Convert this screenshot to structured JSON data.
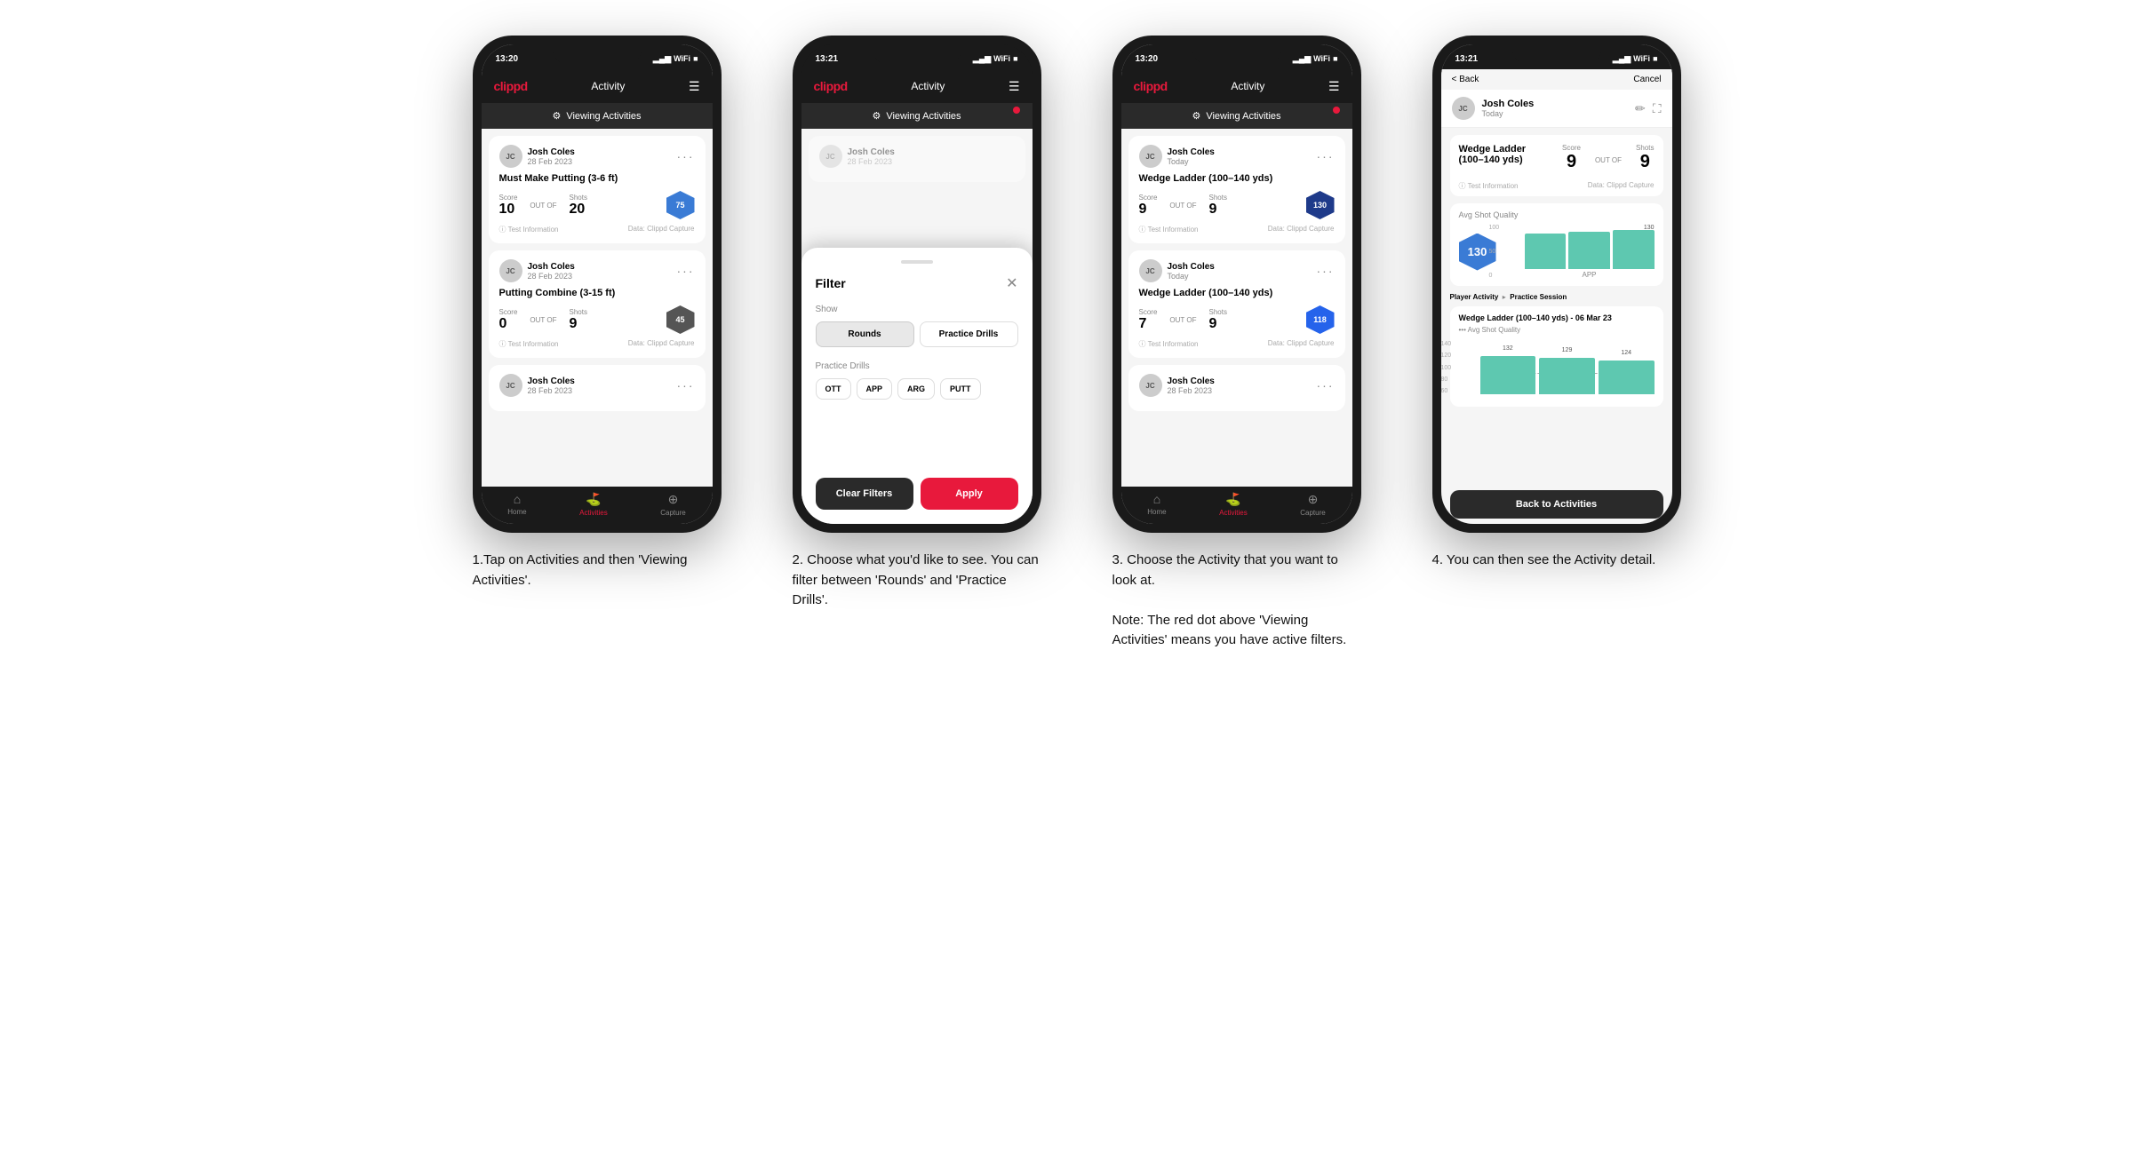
{
  "phones": [
    {
      "id": "phone1",
      "status_time": "13:20",
      "header": {
        "logo": "clippd",
        "title": "Activity",
        "menu_icon": "☰"
      },
      "banner": {
        "label": "Viewing Activities",
        "icon": "⚙",
        "has_red_dot": false
      },
      "cards": [
        {
          "user_name": "Josh Coles",
          "user_date": "28 Feb 2023",
          "drill_title": "Must Make Putting (3-6 ft)",
          "score_label": "Score",
          "shots_label": "Shots",
          "shot_quality_label": "Shot Quality",
          "score": "10",
          "out_of": "OUT OF",
          "shots": "20",
          "shot_quality": "75",
          "info_left": "ⓘ Test Information",
          "info_right": "Data: Clippd Capture"
        },
        {
          "user_name": "Josh Coles",
          "user_date": "28 Feb 2023",
          "drill_title": "Putting Combine (3-15 ft)",
          "score_label": "Score",
          "shots_label": "Shots",
          "shot_quality_label": "Shot Quality",
          "score": "0",
          "out_of": "OUT OF",
          "shots": "9",
          "shot_quality": "45",
          "info_left": "ⓘ Test Information",
          "info_right": "Data: Clippd Capture"
        },
        {
          "user_name": "Josh Coles",
          "user_date": "28 Feb 2023",
          "drill_title": "",
          "score_label": "",
          "shots_label": "",
          "shot_quality_label": "",
          "score": "",
          "out_of": "",
          "shots": "",
          "shot_quality": "",
          "info_left": "",
          "info_right": ""
        }
      ],
      "nav": [
        {
          "label": "Home",
          "icon": "⌂",
          "active": false
        },
        {
          "label": "Activities",
          "icon": "♟",
          "active": true
        },
        {
          "label": "Capture",
          "icon": "⊕",
          "active": false
        }
      ],
      "description": "1.Tap on Activities and then 'Viewing Activities'."
    },
    {
      "id": "phone2",
      "status_time": "13:21",
      "header": {
        "logo": "clippd",
        "title": "Activity",
        "menu_icon": "☰"
      },
      "banner": {
        "label": "Viewing Activities",
        "icon": "⚙",
        "has_red_dot": true
      },
      "filter": {
        "title": "Filter",
        "show_label": "Show",
        "rounds_label": "Rounds",
        "practice_drills_label": "Practice Drills",
        "practice_drills_section_label": "Practice Drills",
        "tags": [
          "OTT",
          "APP",
          "ARG",
          "PUTT"
        ],
        "clear_label": "Clear Filters",
        "apply_label": "Apply"
      },
      "cards": [
        {
          "user_name": "Josh Coles",
          "user_date": "28 Feb 2023"
        }
      ],
      "description": "2. Choose what you'd like to see. You can filter between 'Rounds' and 'Practice Drills'."
    },
    {
      "id": "phone3",
      "status_time": "13:20",
      "header": {
        "logo": "clippd",
        "title": "Activity",
        "menu_icon": "☰"
      },
      "banner": {
        "label": "Viewing Activities",
        "icon": "⚙",
        "has_red_dot": true
      },
      "cards": [
        {
          "user_name": "Josh Coles",
          "user_date": "Today",
          "drill_title": "Wedge Ladder (100–140 yds)",
          "score_label": "Score",
          "shots_label": "Shots",
          "shot_quality_label": "Shot Quality",
          "score": "9",
          "out_of": "OUT OF",
          "shots": "9",
          "shot_quality": "130",
          "info_left": "ⓘ Test Information",
          "info_right": "Data: Clippd Capture"
        },
        {
          "user_name": "Josh Coles",
          "user_date": "Today",
          "drill_title": "Wedge Ladder (100–140 yds)",
          "score_label": "Score",
          "shots_label": "Shots",
          "shot_quality_label": "Shot Quality",
          "score": "7",
          "out_of": "OUT OF",
          "shots": "9",
          "shot_quality": "118",
          "info_left": "ⓘ Test Information",
          "info_right": "Data: Clippd Capture"
        },
        {
          "user_name": "Josh Coles",
          "user_date": "28 Feb 2023",
          "drill_title": "",
          "score_label": "",
          "shots_label": "",
          "shot_quality_label": "",
          "score": "",
          "out_of": "",
          "shots": "",
          "shot_quality": "",
          "info_left": "",
          "info_right": ""
        }
      ],
      "nav": [
        {
          "label": "Home",
          "icon": "⌂",
          "active": false
        },
        {
          "label": "Activities",
          "icon": "♟",
          "active": true
        },
        {
          "label": "Capture",
          "icon": "⊕",
          "active": false
        }
      ],
      "description": "3. Choose the Activity that you want to look at.\n\nNote: The red dot above 'Viewing Activities' means you have active filters."
    },
    {
      "id": "phone4",
      "status_time": "13:21",
      "header": {
        "back_label": "< Back",
        "cancel_label": "Cancel"
      },
      "detail": {
        "user_name": "Josh Coles",
        "user_date": "Today",
        "drill_name": "Wedge Ladder\n(100–140 yds)",
        "score_section_label": "Score",
        "shots_section_label": "Shots",
        "score_value": "9",
        "out_of_text": "OUT OF",
        "shots_value": "9",
        "test_info": "ⓘ Test Information",
        "data_capture": "Data: Clippd Capture",
        "avg_quality_label": "Avg Shot Quality",
        "avg_quality_value": "130",
        "chart_label": "APP",
        "chart_y_values": [
          "100",
          "50",
          "0"
        ],
        "chart_130_label": "130",
        "player_activity_prefix": "Player Activity",
        "practice_session_label": "Practice Session",
        "session_title": "Wedge Ladder (100–140 yds) - 06 Mar 23",
        "session_sub": "••• Avg Shot Quality",
        "bar_values": [
          132,
          129,
          124
        ],
        "bar_labels": [
          "132",
          "129",
          "124"
        ],
        "y_axis_labels": [
          "140",
          "120",
          "100",
          "80",
          "60"
        ],
        "back_to_activities": "Back to Activities"
      },
      "description": "4. You can then see the Activity detail."
    }
  ]
}
